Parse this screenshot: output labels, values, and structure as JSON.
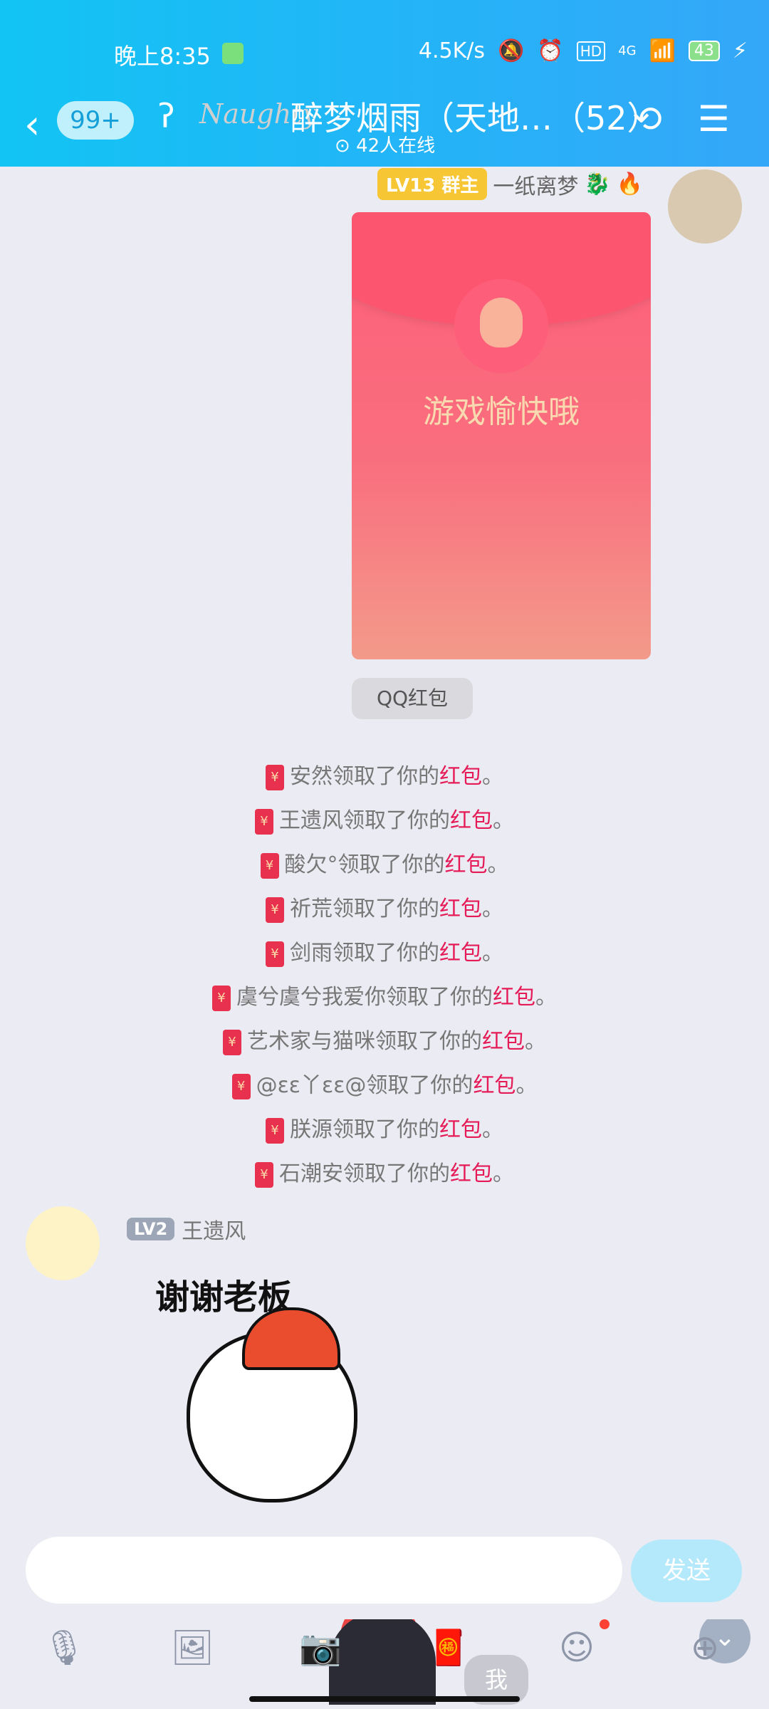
{
  "status_bar": {
    "time": "晚上8:35",
    "speed": "4.5K/s",
    "network": "4G",
    "battery": "43"
  },
  "header": {
    "back_badge": "99+",
    "title": "醉梦烟雨（天地…（52）",
    "online": "42人在线",
    "logo_text": "Naughty"
  },
  "message_top": {
    "level": "LV13 群主",
    "sender": "一纸离梦",
    "packet_text": "游戏愉快哦",
    "packet_label": "QQ红包"
  },
  "notices": [
    {
      "name": "安然领取了你的",
      "hl": "红包",
      "end": "。"
    },
    {
      "name": "王遗风领取了你的",
      "hl": "红包",
      "end": "。"
    },
    {
      "name": "酸欠°领取了你的",
      "hl": "红包",
      "end": "。"
    },
    {
      "name": "祈荒领取了你的",
      "hl": "红包",
      "end": "。"
    },
    {
      "name": "剑雨领取了你的",
      "hl": "红包",
      "end": "。"
    },
    {
      "name": "虞兮虞兮我爱你领取了你的",
      "hl": "红包",
      "end": "。"
    },
    {
      "name": "艺术家与猫咪领取了你的",
      "hl": "红包",
      "end": "。"
    },
    {
      "name": "@εε丫εε@领取了你的",
      "hl": "红包",
      "end": "。"
    },
    {
      "name": "朕源领取了你的",
      "hl": "红包",
      "end": "。"
    },
    {
      "name": "石潮安领取了你的",
      "hl": "红包",
      "end": "。"
    }
  ],
  "message_bottom": {
    "level": "LV2",
    "sender": "王遗风",
    "sticker_text": "谢谢老板",
    "me_bubble": "我"
  },
  "input": {
    "value": "",
    "send_label": "发送"
  },
  "toolbar_icons": [
    "microphone-icon",
    "image-icon",
    "camera-icon",
    "red-packet-icon",
    "emoji-icon",
    "plus-icon"
  ],
  "colors": {
    "header_start": "#12c4f4",
    "header_end": "#35a7f8",
    "highlight": "#e51b58",
    "packet": "#fd5f7a"
  }
}
